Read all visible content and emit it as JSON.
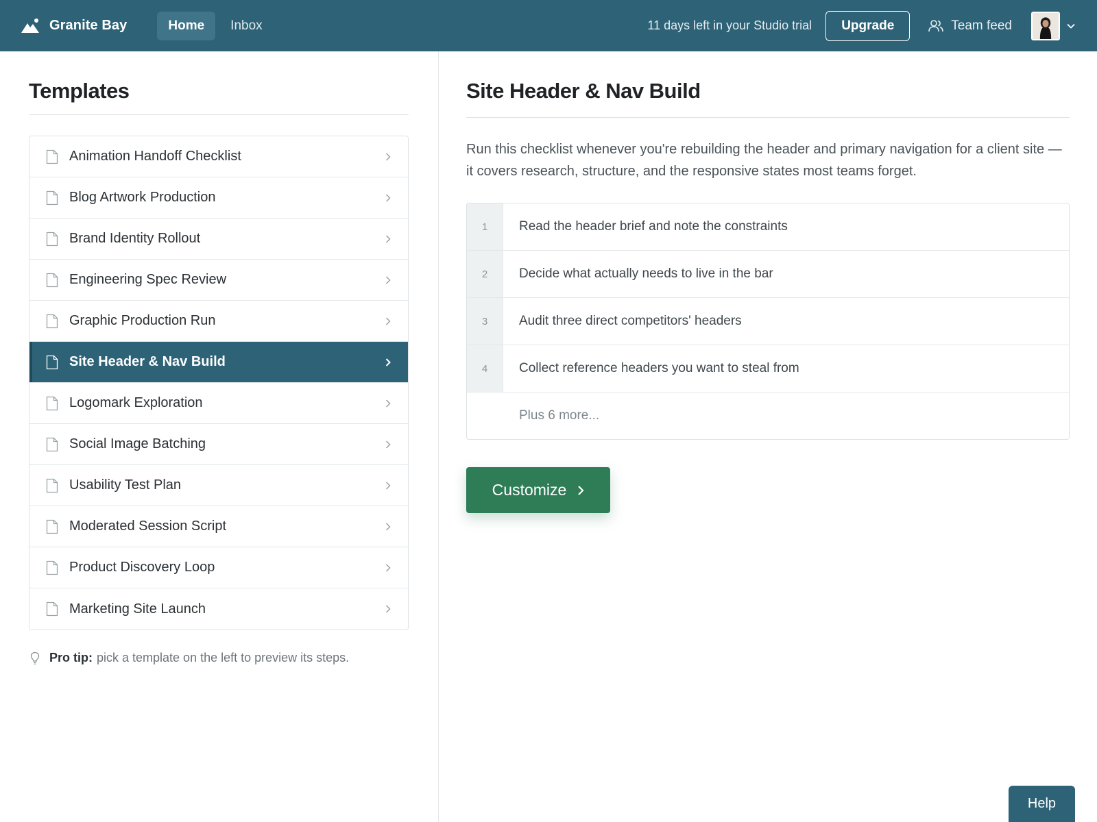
{
  "app": {
    "name": "Granite Bay",
    "logo_icon": "mountain-icon"
  },
  "nav": {
    "items": [
      {
        "label": "Home",
        "active": true
      },
      {
        "label": "Inbox",
        "active": false
      }
    ]
  },
  "header": {
    "trial_text": "11 days left in your Studio trial",
    "upgrade_label": "Upgrade",
    "team_feed_label": "Team feed",
    "team_feed_icon": "users-icon"
  },
  "templates": {
    "title": "Templates",
    "items": [
      {
        "label": "Animation Handoff Checklist"
      },
      {
        "label": "Blog Artwork Production"
      },
      {
        "label": "Brand Identity Rollout"
      },
      {
        "label": "Engineering Spec Review"
      },
      {
        "label": "Graphic Production Run"
      },
      {
        "label": "Site Header & Nav Build",
        "selected": true
      },
      {
        "label": "Logomark Exploration"
      },
      {
        "label": "Social Image Batching"
      },
      {
        "label": "Usability Test Plan"
      },
      {
        "label": "Moderated Session Script"
      },
      {
        "label": "Product Discovery Loop"
      },
      {
        "label": "Marketing Site Launch"
      }
    ],
    "pro_tip_label": "Pro tip:",
    "pro_tip_text": "pick a template on the left to preview its steps."
  },
  "preview": {
    "title": "Site Header & Nav Build",
    "description": "Run this checklist whenever you're rebuilding the header and primary navigation for a client site — it covers research, structure, and the responsive states most teams forget.",
    "steps": [
      {
        "num": "1",
        "text": "Read the header brief and note the constraints"
      },
      {
        "num": "2",
        "text": "Decide what actually needs to live in the bar"
      },
      {
        "num": "3",
        "text": "Audit three direct competitors' headers"
      },
      {
        "num": "4",
        "text": "Collect reference headers you want to steal from"
      }
    ],
    "more_text": "Plus 6 more...",
    "customize_label": "Customize"
  },
  "help": {
    "label": "Help"
  },
  "colors": {
    "header_bg": "#2e6277",
    "selected_bg": "#2e6277",
    "customize_bg": "#2f7d57"
  }
}
